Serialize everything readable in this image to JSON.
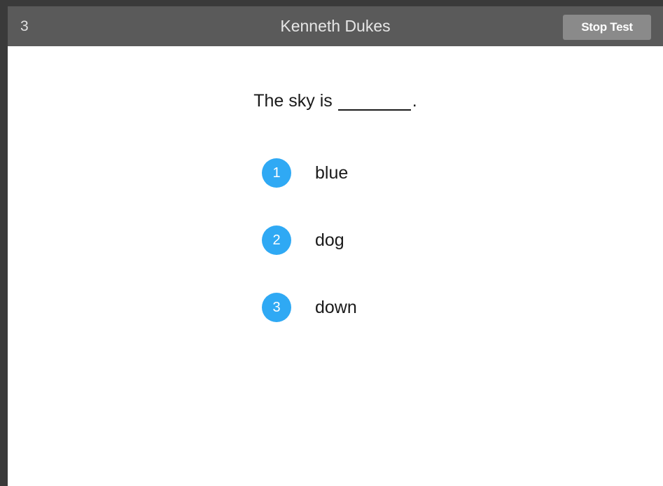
{
  "header": {
    "question_number": "3",
    "student_name": "Kenneth Dukes",
    "stop_button_label": "Stop Test"
  },
  "question": {
    "prefix": "The sky is",
    "suffix": "."
  },
  "options": [
    {
      "number": "1",
      "label": "blue"
    },
    {
      "number": "2",
      "label": "dog"
    },
    {
      "number": "3",
      "label": "down"
    }
  ],
  "colors": {
    "header_bg": "#5a5a5a",
    "frame": "#3a3a3a",
    "stop_button_bg": "#8a8a8a",
    "option_badge": "#2fa9f4"
  }
}
